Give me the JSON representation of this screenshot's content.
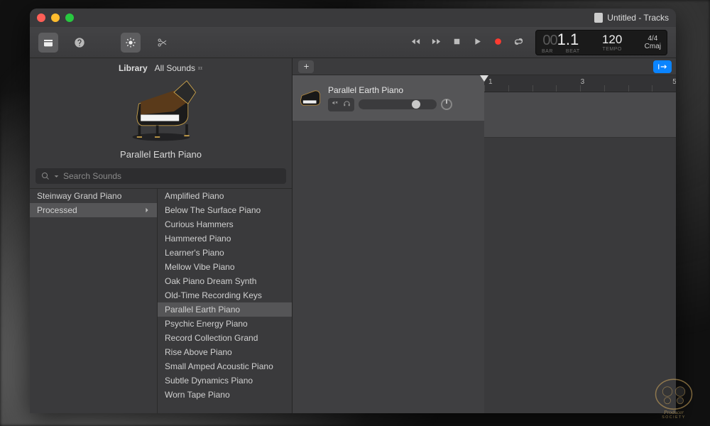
{
  "window": {
    "title": "Untitled - Tracks"
  },
  "lcd": {
    "bar_prefix": "00",
    "bar": "1",
    "beat": "1",
    "bar_label": "BAR",
    "beat_label": "BEAT",
    "tempo": "120",
    "tempo_label": "TEMPO",
    "sig": "4/4",
    "key": "Cmaj"
  },
  "library": {
    "label": "Library",
    "dropdown": "All Sounds",
    "preview_name": "Parallel Earth Piano",
    "search_placeholder": "Search Sounds",
    "col1": [
      {
        "label": "Steinway Grand Piano",
        "selected": false,
        "chevron": false
      },
      {
        "label": "Processed",
        "selected": true,
        "chevron": true
      }
    ],
    "col2": [
      "Amplified Piano",
      "Below The Surface Piano",
      "Curious Hammers",
      "Hammered Piano",
      "Learner's Piano",
      "Mellow Vibe Piano",
      "Oak Piano Dream Synth",
      "Old-Time Recording Keys",
      "Parallel Earth Piano",
      "Psychic Energy Piano",
      "Record Collection Grand",
      "Rise Above Piano",
      "Small Amped Acoustic Piano",
      "Subtle Dynamics Piano",
      "Worn Tape Piano"
    ],
    "col2_selected": "Parallel Earth Piano"
  },
  "track": {
    "name": "Parallel Earth Piano"
  },
  "ruler": [
    "1",
    "3",
    "5"
  ],
  "watermark": "PRODUCER SOCIETY"
}
